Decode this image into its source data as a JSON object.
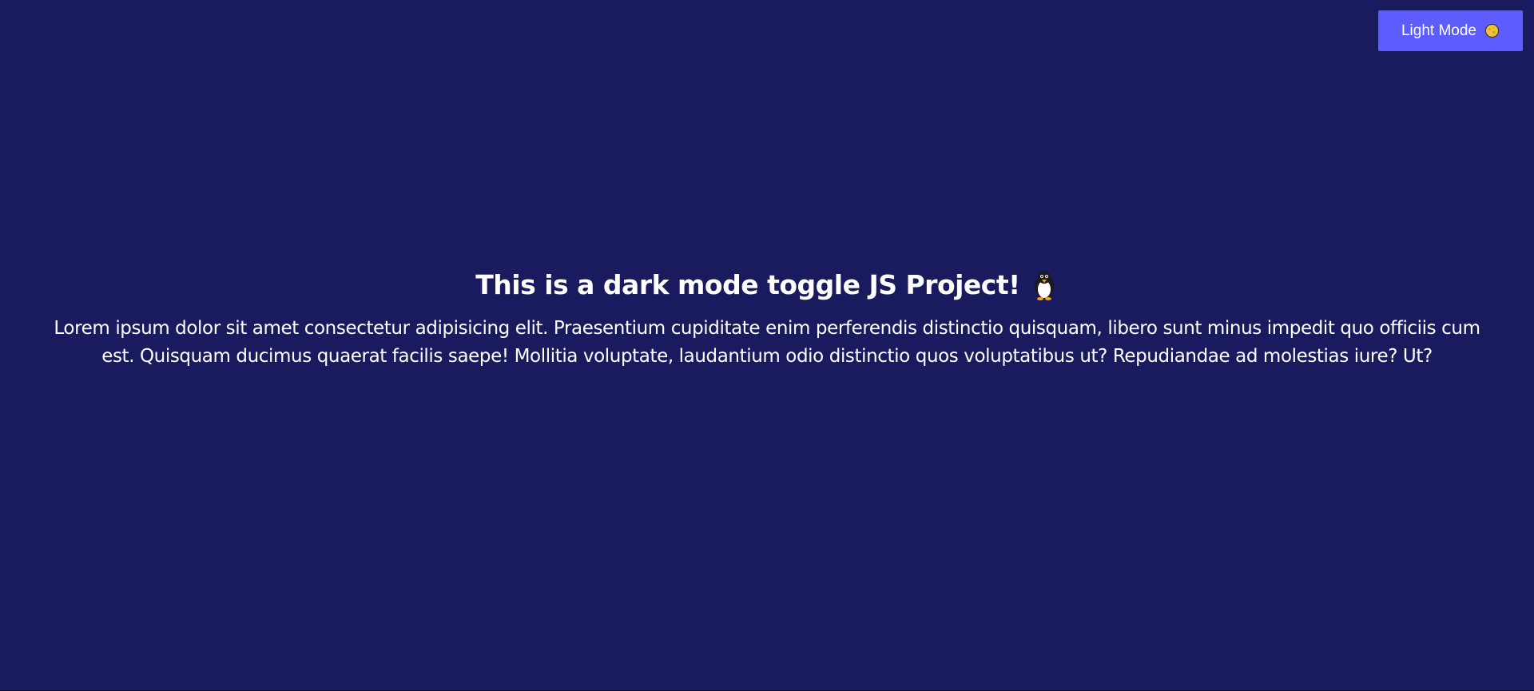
{
  "theme": {
    "background": "#1a1a5e",
    "text": "#ffffff",
    "button_background": "#5c5cff"
  },
  "toggle": {
    "label": "Light Mode",
    "icon": "moon-icon"
  },
  "main": {
    "title": "This is a dark mode toggle JS Project!",
    "title_icon": "penguin-icon",
    "paragraph": "Lorem ipsum dolor sit amet consectetur adipisicing elit. Praesentium cupiditate enim perferendis distinctio quisquam, libero sunt minus impedit quo officiis cum est. Quisquam ducimus quaerat facilis saepe! Mollitia voluptate, laudantium odio distinctio quos voluptatibus ut? Repudiandae ad molestias iure? Ut?"
  }
}
